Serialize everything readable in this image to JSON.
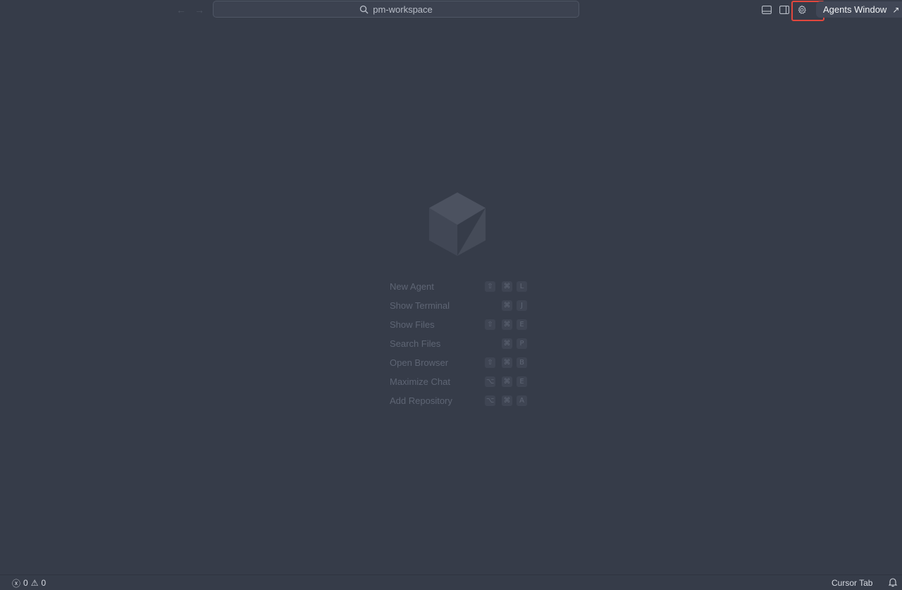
{
  "titlebar": {
    "back_glyph": "←",
    "forward_glyph": "→",
    "search": {
      "icon": "search-icon",
      "text": "pm-workspace"
    },
    "icons": [
      "panel-toggle-icon",
      "sidebar-toggle-icon",
      "gear-icon"
    ],
    "agents_window": {
      "label": "Agents Window",
      "arrow": "↗"
    }
  },
  "shortcuts": [
    {
      "label": "New Agent",
      "keys": [
        "⇧",
        "⌘",
        "L"
      ]
    },
    {
      "label": "Show Terminal",
      "keys": [
        "",
        "⌘",
        "J"
      ]
    },
    {
      "label": "Show Files",
      "keys": [
        "⇧",
        "⌘",
        "E"
      ]
    },
    {
      "label": "Search Files",
      "keys": [
        "",
        "⌘",
        "P"
      ]
    },
    {
      "label": "Open Browser",
      "keys": [
        "⇧",
        "⌘",
        "B"
      ]
    },
    {
      "label": "Maximize Chat",
      "keys": [
        "⌥",
        "⌘",
        "E"
      ]
    },
    {
      "label": "Add Repository",
      "keys": [
        "⌥",
        "⌘",
        "A"
      ]
    }
  ],
  "statusbar": {
    "errors_icon": "ⓧ",
    "errors": "0",
    "warnings_icon": "⚠",
    "warnings": "0",
    "cursor_tab": "Cursor Tab"
  },
  "colors": {
    "background": "#363c49",
    "highlight": "#e2473d"
  }
}
